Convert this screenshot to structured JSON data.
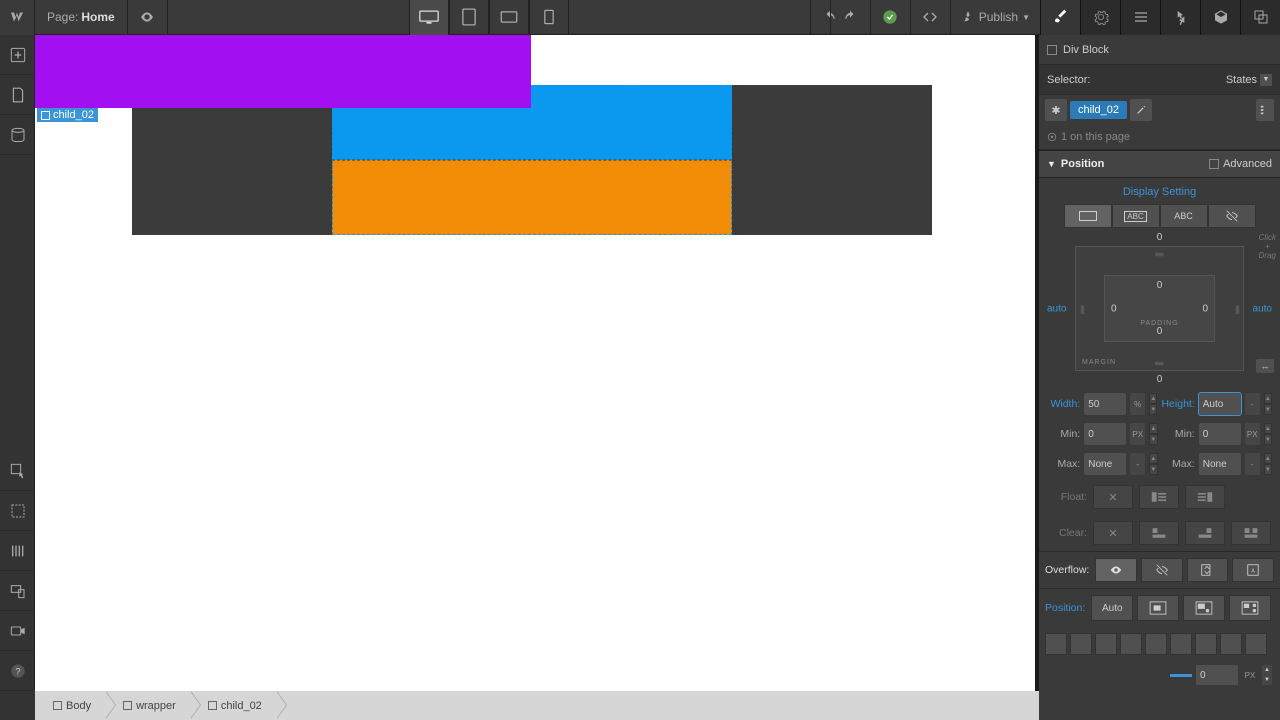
{
  "topbar": {
    "page_prefix": "Page:",
    "page_name": "Home",
    "publish": "Publish"
  },
  "selected_label": "child_02",
  "rightpanel": {
    "div_block": "Div Block",
    "selector_label": "Selector:",
    "states_label": "States",
    "selector_tag": "child_02",
    "on_page": "1 on this page",
    "position_section": "Position",
    "advanced": "Advanced",
    "display_setting": "Display Setting",
    "abc": "ABC",
    "margin_top": "0",
    "margin_bottom": "0",
    "margin_left": "auto",
    "margin_right": "auto",
    "padding_top": "0",
    "padding_bottom": "0",
    "padding_left": "0",
    "padding_right": "0",
    "padding_label": "PADDING",
    "margin_label": "MARGIN",
    "click_drag": "Click\n+\nDrag",
    "width_label": "Width:",
    "width_value": "50",
    "width_unit": "%",
    "height_label": "Height:",
    "height_value": "Auto",
    "height_unit": "-",
    "min_label": "Min:",
    "min_w_value": "0",
    "min_w_unit": "PX",
    "min_h_value": "0",
    "min_h_unit": "PX",
    "max_label": "Max:",
    "max_w_value": "None",
    "max_w_unit": "-",
    "max_h_value": "None",
    "max_h_unit": "-",
    "float_label": "Float:",
    "clear_label": "Clear:",
    "overflow_label": "Overflow:",
    "position_label": "Position:",
    "position_auto": "Auto",
    "z_value": "0",
    "z_unit": "PX"
  },
  "breadcrumb": {
    "body": "Body",
    "wrapper": "wrapper",
    "child": "child_02"
  }
}
